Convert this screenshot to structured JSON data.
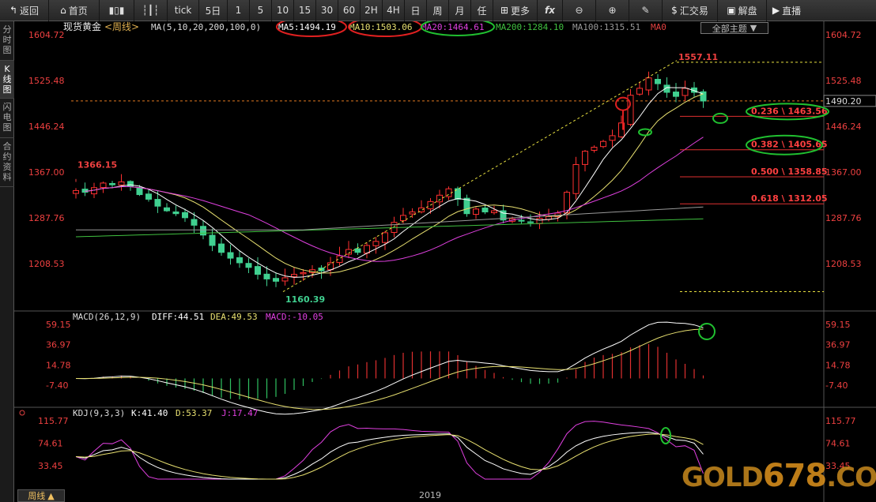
{
  "toolbar": {
    "back": "返回",
    "home": "首页",
    "tick": "tick",
    "periods": [
      "5日",
      "1",
      "5",
      "10",
      "15",
      "30",
      "60",
      "2H",
      "4H",
      "日",
      "周",
      "月",
      "任"
    ],
    "more": "更多",
    "fx": "fx",
    "trade": "汇交易",
    "unlock": "解盘",
    "live": "直播"
  },
  "side_tabs": [
    "分时图",
    "K线图",
    "闪电图",
    "合约资料"
  ],
  "theme_select": "全部主题",
  "main": {
    "instrument": "现货黄金",
    "period_tag": "<周线>",
    "ma_params": "MA(5,10,20,200,100,0)",
    "ma5": "MA5:1494.19",
    "ma10": "MA10:1503.06",
    "ma20": "MA20:1464.61",
    "ma200": "MA200:1284.10",
    "ma100": "MA100:1315.51",
    "ma0": "MA0",
    "y_ticks": [
      "1604.72",
      "1525.48",
      "1446.24",
      "1367.00",
      "1287.76",
      "1208.53"
    ],
    "current_price": "1490.20",
    "high_label": "1557.11",
    "low_label": "1160.39",
    "left_high_label": "1366.15",
    "fib": [
      "0.236 \\ 1463.56",
      "0.382 \\ 1405.65",
      "0.500 \\ 1358.85",
      "0.618 \\ 1312.05"
    ]
  },
  "macd": {
    "params": "MACD(26,12,9)",
    "diff": "DIFF:44.51",
    "dea": "DEA:49.53",
    "macd": "MACD:-10.05",
    "y_ticks": [
      "59.15",
      "36.97",
      "14.78",
      "-7.40"
    ]
  },
  "kdj": {
    "params": "KDJ(9,3,3)",
    "k": "K:41.40",
    "d": "D:53.37",
    "j": "J:17.47",
    "y_ticks": [
      "115.77",
      "74.61",
      "33.45"
    ]
  },
  "footer": {
    "period": "周线",
    "year": "2019"
  },
  "watermark": {
    "pre": "GOLD",
    "num": "678",
    "post": ".COM"
  },
  "colors": {
    "up": "#ff3030",
    "down": "#40d090",
    "ma5": "#ffffff",
    "ma10": "#e8e070",
    "ma20": "#e040e0",
    "ma200": "#40c040",
    "ma100": "#999999"
  },
  "chart_data": {
    "type": "candlestick",
    "weekly_closes": [
      1335,
      1332,
      1340,
      1348,
      1345,
      1350,
      1342,
      1328,
      1320,
      1308,
      1300,
      1295,
      1288,
      1275,
      1258,
      1240,
      1228,
      1218,
      1210,
      1202,
      1190,
      1182,
      1178,
      1184,
      1190,
      1193,
      1198,
      1196,
      1210,
      1222,
      1233,
      1228,
      1240,
      1247,
      1262,
      1280,
      1292,
      1298,
      1305,
      1316,
      1327,
      1338,
      1320,
      1295,
      1303,
      1298,
      1300,
      1284,
      1286,
      1282,
      1280,
      1287,
      1290,
      1296,
      1332,
      1380,
      1403,
      1410,
      1420,
      1430,
      1452,
      1500,
      1512,
      1530,
      1520,
      1505,
      1498,
      1512,
      1505,
      1490
    ]
  }
}
